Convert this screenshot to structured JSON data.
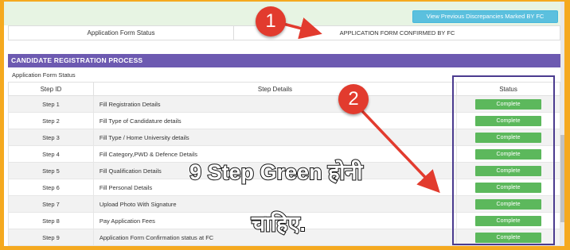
{
  "header": {
    "prev_button_label": "View Previous Discrepancies Marked BY FC",
    "form_status_label": "Application Form Status",
    "form_status_value": "APPLICATION FORM CONFIRMED BY FC"
  },
  "section": {
    "title": "CANDIDATE REGISTRATION PROCESS",
    "subtitle": "Application Form Status"
  },
  "table": {
    "columns": [
      "Step ID",
      "Step Details",
      "Status"
    ],
    "rows": [
      {
        "id": "Step 1",
        "details": "Fill Registration Details",
        "status": "Complete"
      },
      {
        "id": "Step 2",
        "details": "Fill Type of Candidature details",
        "status": "Complete"
      },
      {
        "id": "Step 3",
        "details": "Fill Type / Home University details",
        "status": "Complete"
      },
      {
        "id": "Step 4",
        "details": "Fill Category,PWD & Defence Details",
        "status": "Complete"
      },
      {
        "id": "Step 5",
        "details": "Fill Qualification Details",
        "status": "Complete"
      },
      {
        "id": "Step 6",
        "details": "Fill Personal Details",
        "status": "Complete"
      },
      {
        "id": "Step 7",
        "details": "Upload Photo With Signature",
        "status": "Complete"
      },
      {
        "id": "Step 8",
        "details": "Pay Application Fees",
        "status": "Complete"
      },
      {
        "id": "Step 9",
        "details": "Application Form Confirmation status at FC",
        "status": "Complete"
      }
    ]
  },
  "annotations": {
    "marker_1": "1",
    "marker_2": "2",
    "overlay_line_1": "9 Step Green होनी",
    "overlay_line_2": "चाहिए."
  },
  "colors": {
    "border_orange": "#f5a91f",
    "section_purple": "#6d5ab1",
    "complete_green": "#5cb85c",
    "button_blue": "#5bc0de",
    "marker_red": "#e23b2e"
  }
}
